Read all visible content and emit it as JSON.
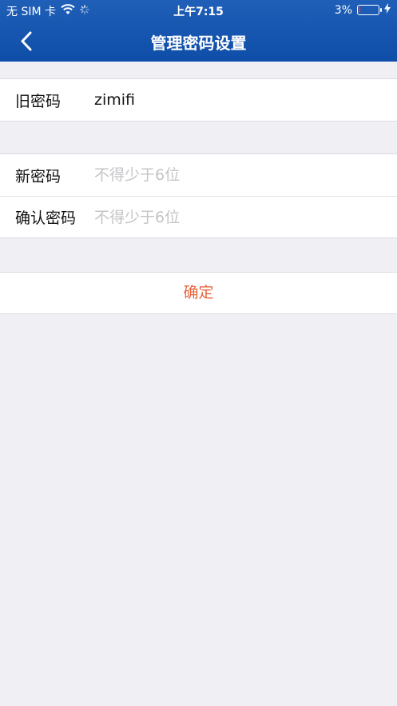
{
  "status_bar": {
    "carrier": "无 SIM 卡",
    "time": "上午7:15",
    "battery_percent": "3%",
    "battery_level": 0.03
  },
  "nav": {
    "title": "管理密码设置"
  },
  "old_password": {
    "label": "旧密码",
    "value": "zimifi"
  },
  "new_password": {
    "label": "新密码",
    "placeholder": "不得少于6位"
  },
  "confirm_password": {
    "label": "确认密码",
    "placeholder": "不得少于6位"
  },
  "confirm_button": {
    "label": "确定"
  },
  "colors": {
    "header": "#1f5fb8",
    "accent": "#e8653d",
    "background": "#efeff4"
  }
}
